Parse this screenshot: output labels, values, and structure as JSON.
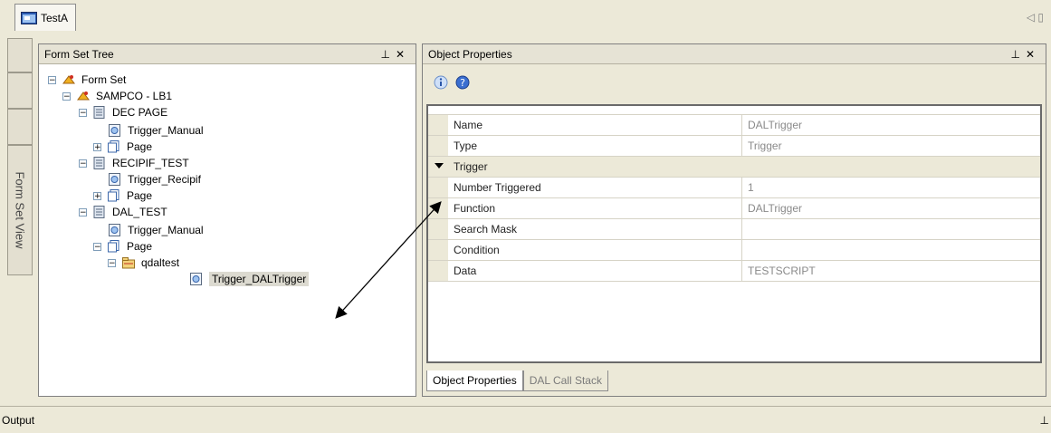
{
  "document": {
    "tab_label": "TestA",
    "scroll_glyph": "◁ ▯"
  },
  "side_tab": {
    "label": "Form Set View"
  },
  "tree_panel": {
    "title": "Form Set Tree",
    "pin_glyph": "⊥",
    "close_glyph": "✕",
    "nodes": [
      {
        "label": "Form Set",
        "expander": "−",
        "icon": "form-set-icon"
      },
      {
        "label": "SAMPCO - LB1",
        "expander": "−",
        "icon": "form-set-icon"
      },
      {
        "label": "DEC PAGE",
        "expander": "−",
        "icon": "form-icon"
      },
      {
        "label": "Trigger_Manual",
        "expander": "",
        "icon": "trigger-icon"
      },
      {
        "label": "Page",
        "expander": "+",
        "icon": "page-icon"
      },
      {
        "label": "RECIPIF_TEST",
        "expander": "−",
        "icon": "form-icon"
      },
      {
        "label": "Trigger_Recipif",
        "expander": "",
        "icon": "trigger-icon"
      },
      {
        "label": "Page",
        "expander": "+",
        "icon": "page-icon"
      },
      {
        "label": "DAL_TEST",
        "expander": "−",
        "icon": "form-icon"
      },
      {
        "label": "Trigger_Manual",
        "expander": "",
        "icon": "trigger-icon"
      },
      {
        "label": "Page",
        "expander": "−",
        "icon": "page-icon"
      },
      {
        "label": "qdaltest",
        "expander": "−",
        "icon": "section-icon"
      },
      {
        "label": "Trigger_DALTrigger",
        "expander": "",
        "icon": "trigger-icon",
        "selected": true
      }
    ]
  },
  "props_panel": {
    "title": "Object Properties",
    "pin_glyph": "⊥",
    "close_glyph": "✕",
    "rows": [
      {
        "name": "Name",
        "value": "DALTrigger"
      },
      {
        "name": "Type",
        "value": "Trigger"
      },
      {
        "category": "Trigger"
      },
      {
        "name": "Number Triggered",
        "value": "1"
      },
      {
        "name": "Function",
        "value": "DALTrigger"
      },
      {
        "name": "Search Mask",
        "value": ""
      },
      {
        "name": "Condition",
        "value": ""
      },
      {
        "name": "Data",
        "value": "TESTSCRIPT"
      }
    ],
    "tabs": [
      "Object Properties",
      "DAL Call Stack"
    ],
    "active_tab": "Object Properties"
  },
  "output": {
    "label": "Output",
    "pin_glyph": "⊥"
  },
  "colors": {
    "accent_arrow": "#000000",
    "panel_header": "#e6e3d5",
    "window_bg": "#ece9d8"
  }
}
